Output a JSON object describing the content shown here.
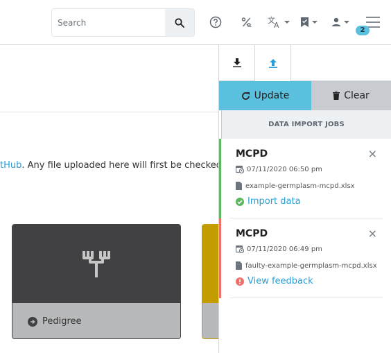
{
  "navbar": {
    "search_placeholder": "Search",
    "icons": [
      "search-icon",
      "help-icon",
      "percent-slash-icon",
      "translate-icon",
      "bookmark-check-icon",
      "user-icon",
      "menu-icon"
    ],
    "notification_count": "2"
  },
  "main": {
    "intro_link_fragment": "tHub",
    "intro_text": ". Any file uploaded here will first be checked fo",
    "cards": [
      {
        "label": "Pedigree",
        "icon": "pedigree-icon",
        "color": "#414143"
      },
      {
        "label": "",
        "icon": "",
        "color": "#c39d00"
      }
    ]
  },
  "sidebar": {
    "tabs": [
      {
        "name": "download",
        "icon": "download-icon"
      },
      {
        "name": "upload",
        "icon": "upload-icon",
        "active": true
      }
    ],
    "update_label": "Update",
    "clear_label": "Clear",
    "jobs_header": "DATA IMPORT JOBS",
    "jobs": [
      {
        "title": "MCPD",
        "datetime": "07/11/2020 06:50 pm",
        "filename": "example-germplasm-mcpd.xlsx",
        "action": "Import data",
        "status": "success",
        "status_color": "#5cb85c"
      },
      {
        "title": "MCPD",
        "datetime": "07/11/2020 06:49 pm",
        "filename": "faulty-example-germplasm-mcpd.xlsx",
        "action": "View feedback",
        "status": "error",
        "status_color": "#f0706a"
      }
    ]
  },
  "colors": {
    "accent": "#5bc0de",
    "link": "#2a9fd6",
    "success": "#5cb85c",
    "danger": "#f0706a"
  }
}
